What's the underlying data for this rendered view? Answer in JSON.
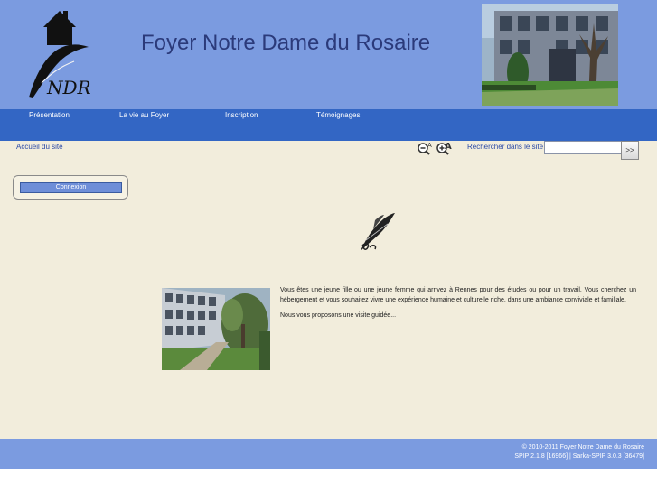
{
  "header": {
    "site_title": "Foyer Notre Dame du Rosaire",
    "logo_text": "NDR"
  },
  "nav": {
    "items": [
      {
        "label": "Présentation"
      },
      {
        "label": "La vie au Foyer"
      },
      {
        "label": "Inscription"
      },
      {
        "label": "Témoignages"
      }
    ]
  },
  "toolbar": {
    "breadcrumb": "Accueil du site",
    "zoom_out_icon": "zoom-out-icon",
    "zoom_in_icon": "zoom-in-icon",
    "search_label": "Rechercher dans le site",
    "search_value": "",
    "search_button": ">>"
  },
  "login": {
    "button_label": "Connexion"
  },
  "content": {
    "paragraph_1": "Vous êtes une jeune fille ou une jeune femme qui arrivez à Rennes pour des études ou pour un travail. Vous cherchez un hébergement et vous souhaitez vivre une expérience humaine et culturelle riche, dans une ambiance conviviale et familiale.",
    "paragraph_2": "Nous vous proposons une visite guidée..."
  },
  "footer": {
    "line_1": "© 2010-2011 Foyer Notre Dame du Rosaire",
    "line_2": "SPIP 2.1.8 [16966] | Sarka-SPIP 3.0.3 [36479]"
  },
  "colors": {
    "header_bg": "#7b9be0",
    "nav_bg": "#3366c4",
    "page_bg": "#f2eddc",
    "title": "#2b3a7a",
    "link": "#2b4aa6"
  }
}
